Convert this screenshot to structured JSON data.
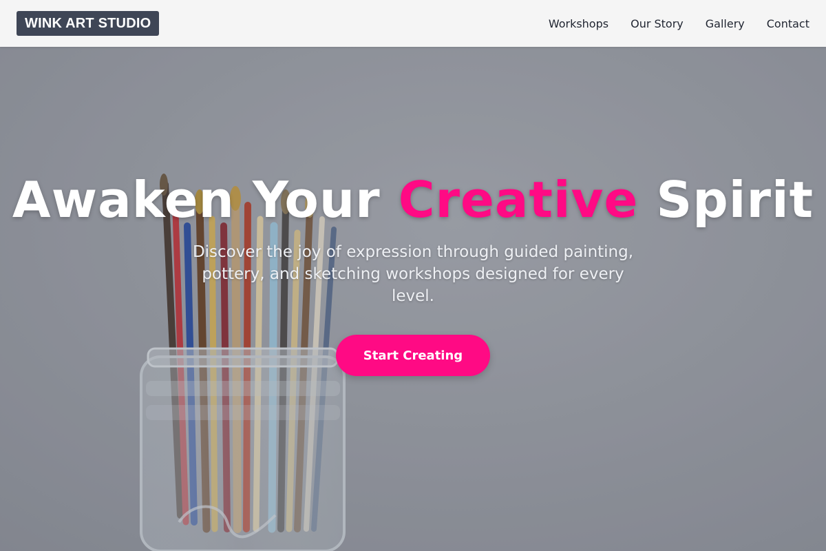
{
  "brand": {
    "name": "WINK ART STUDIO"
  },
  "nav": {
    "items": [
      {
        "label": "Workshops"
      },
      {
        "label": "Our Story"
      },
      {
        "label": "Gallery"
      },
      {
        "label": "Contact"
      }
    ]
  },
  "hero": {
    "title_part1": "Awaken Your ",
    "title_accent": "Creative",
    "title_part2": " Spirit",
    "subtitle": "Discover the joy of expression through guided painting, pottery, and sketching workshops designed for every level.",
    "cta_label": "Start Creating",
    "background_image": "paintbrushes-in-glass-jar-icon"
  },
  "colors": {
    "accent": "#ff0a84",
    "logo_bg": "#3f4656",
    "nav_bg": "#f5f5f5"
  }
}
